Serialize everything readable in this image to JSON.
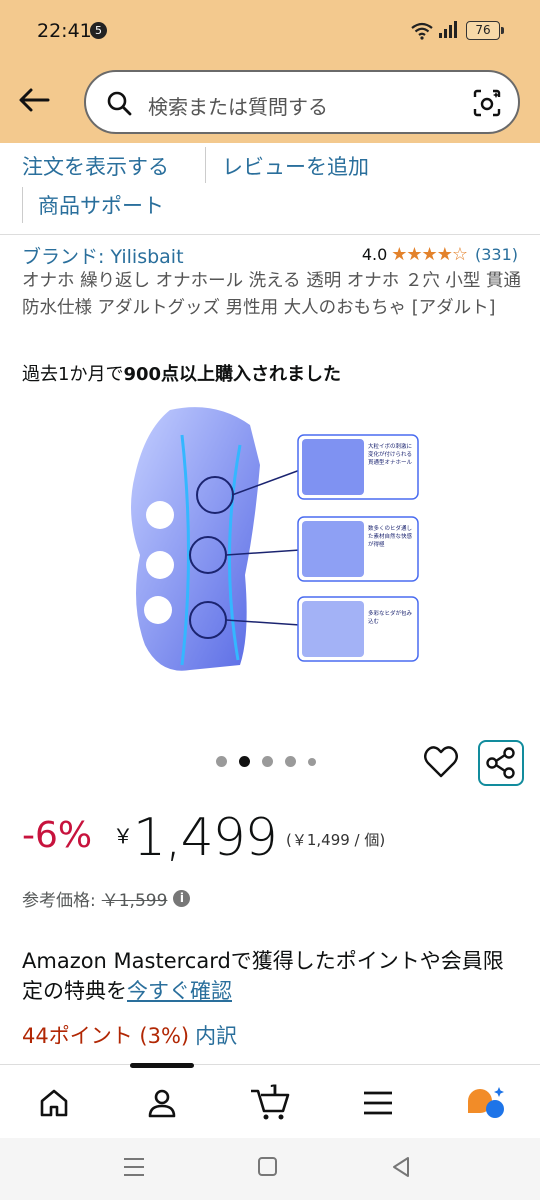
{
  "status": {
    "time": "22:41",
    "notification_count": "5",
    "battery": "76"
  },
  "header": {
    "search_placeholder": "検索または質問する"
  },
  "links": {
    "view_order": "注文を表示する",
    "add_review": "レビューを追加",
    "product_support": "商品サポート"
  },
  "product": {
    "brand": "ブランド: Yilisbait",
    "rating": "4.0",
    "stars": "★★★★☆",
    "review_count": "(331)",
    "title": "オナホ 繰り返し オナホール 洗える 透明 オナホ ２穴 小型 貫通 防水仕様 アダルトグッズ 男性用 大人のおもちゃ [アダルト]",
    "bought_prefix": "過去1か月で",
    "bought_bold": "900点以上購入されました",
    "image_callouts": [
      "大粒イボの刺激に変化が付けられる貫通型オナホール",
      "数多くのヒダ通した素材自然な快感が得極",
      "多彩なヒダが包み込む"
    ],
    "image_count": 5,
    "active_image_index": 1
  },
  "price": {
    "discount": "-6%",
    "currency": "￥",
    "amount": "1,499",
    "unit_price": "(￥1,499 / 個)",
    "ref_label": "参考価格:",
    "ref_price": "￥1,599"
  },
  "promo": {
    "text": "Amazon Mastercardで獲得したポイントや会員限定の特典を",
    "link": "今すぐ確認"
  },
  "points": {
    "text": "44ポイント (3%)",
    "breakdown": "内訳"
  },
  "bottom_nav": {
    "cart_count": "1"
  },
  "colors": {
    "header_bg": "#f3c98e",
    "link": "#2a6f9c",
    "discount": "#c7133d",
    "star": "#e3822b",
    "share_border": "#128c9d"
  }
}
